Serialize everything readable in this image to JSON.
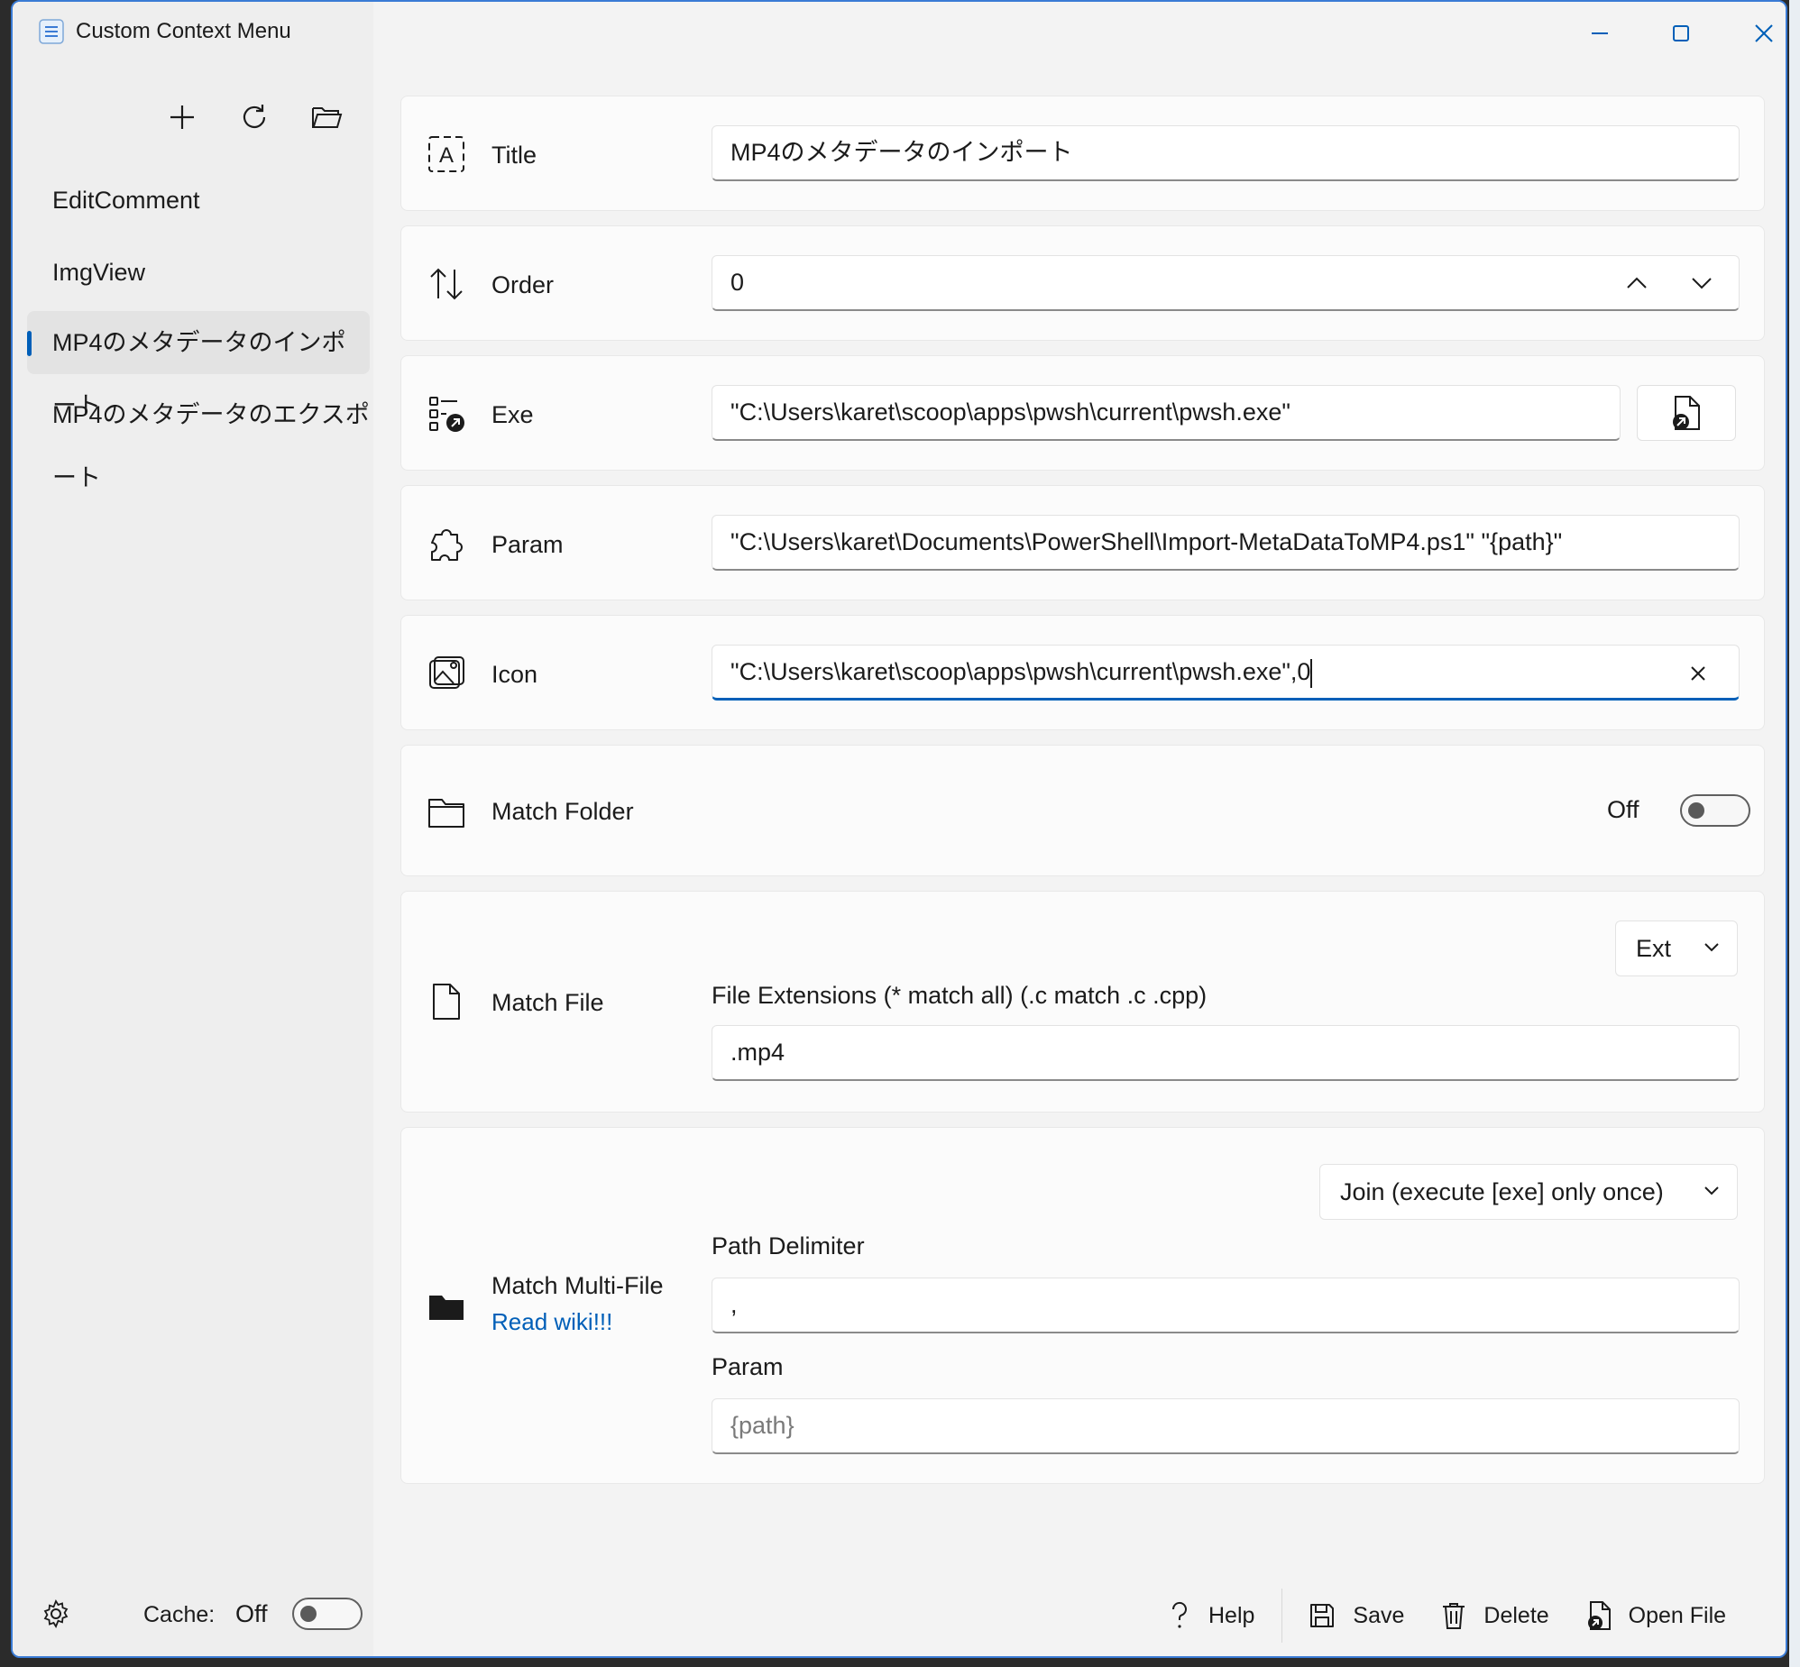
{
  "window": {
    "title": "Custom Context Menu",
    "icon": "hamburger-menu-icon",
    "accent_color": "#005fb8"
  },
  "sidebar": {
    "toolbar": {
      "add_icon": "plus-icon",
      "refresh_icon": "refresh-icon",
      "open_folder_icon": "folder-open-icon"
    },
    "items": [
      {
        "label": "EditComment",
        "selected": false
      },
      {
        "label": "ImgView",
        "selected": false
      },
      {
        "label": "MP4のメタデータのインポート",
        "selected": true
      },
      {
        "label": "MP4のメタデータのエクスポート",
        "selected": false
      }
    ],
    "footer": {
      "settings_icon": "gear-icon",
      "cache_label": "Cache:",
      "cache_state": "Off",
      "cache_on": false
    }
  },
  "form": {
    "title": {
      "label": "Title",
      "value": "MP4のメタデータのインポート"
    },
    "order": {
      "label": "Order",
      "value": "0"
    },
    "exe": {
      "label": "Exe",
      "value": "\"C:\\Users\\karet\\scoop\\apps\\pwsh\\current\\pwsh.exe\""
    },
    "param": {
      "label": "Param",
      "value": "\"C:\\Users\\karet\\Documents\\PowerShell\\Import-MetaDataToMP4.ps1\" \"{path}\""
    },
    "icon": {
      "label": "Icon",
      "value": "\"C:\\Users\\karet\\scoop\\apps\\pwsh\\current\\pwsh.exe\",0"
    },
    "match_folder": {
      "label": "Match Folder",
      "state": "Off",
      "on": false
    },
    "match_file": {
      "label": "Match File",
      "mode": "Ext",
      "sublabel": "File Extensions (* match all)  (.c match .c .cpp)",
      "value": ".mp4"
    },
    "match_multi_file": {
      "label": "Match Multi-File",
      "link": "Read wiki!!!",
      "mode": "Join (execute [exe] only once)",
      "delimiter_label": "Path Delimiter",
      "delimiter_value": ",",
      "param_label": "Param",
      "param_placeholder": "{path}"
    }
  },
  "actions": {
    "help": "Help",
    "save": "Save",
    "delete": "Delete",
    "open_file": "Open File"
  }
}
